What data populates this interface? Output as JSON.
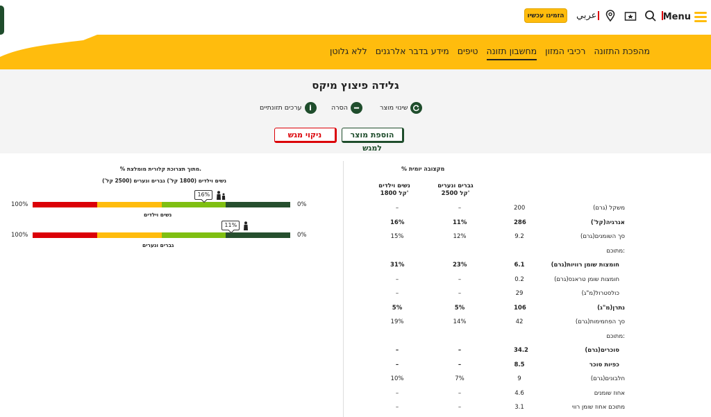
{
  "header": {
    "menu_label": "Menu",
    "order_button": "הזמינו עכשיו",
    "language_link": "عربي"
  },
  "nav": {
    "items": [
      "מהפכת התזונה",
      "רכיבי המזון",
      "מחשבון תזונה",
      "טיפים",
      "מידע בדבר אלרגנים",
      "ללא גלוטן"
    ],
    "active_index": 2
  },
  "product": {
    "title": "גלידה פיצוץ מיקס",
    "legend": {
      "change_product": "שינוי מוצר",
      "remove": "הסרה",
      "nutrition_values": "ערכים תזונתיים"
    },
    "add_to_tray": "הוספת מוצר למגש",
    "clear_tray": "ניקוי מגש"
  },
  "table": {
    "daily_header": "% מקצובה יומית",
    "col_men": [
      "גברים ונערים",
      "2500 קל'"
    ],
    "col_women": [
      "נשים וילדים",
      "1800 קל'"
    ],
    "rows": [
      {
        "label": "משקל (גרם)",
        "value": "200",
        "men": "–",
        "women": "–",
        "bold": false,
        "indent": false
      },
      {
        "label": "אנרגיה(קל')",
        "value": "286",
        "men": "11%",
        "women": "16%",
        "bold": true,
        "indent": false
      },
      {
        "label": "סך השומנים(גרם)",
        "value": "9.2",
        "men": "12%",
        "women": "15%",
        "bold": false,
        "indent": false
      },
      {
        "label": "מתוכם:",
        "value": "",
        "men": "",
        "women": "",
        "bold": false,
        "indent": false
      },
      {
        "label": "חומצות שומן רוויות(גרם)",
        "value": "6.1",
        "men": "23%",
        "women": "31%",
        "bold": true,
        "indent": true
      },
      {
        "label": "חומצות שומן טראנס(גרם)",
        "value": "0.2",
        "men": "–",
        "women": "–",
        "bold": false,
        "indent": true
      },
      {
        "label": "כולסטרול(מ\"ג)",
        "value": "29",
        "men": "–",
        "women": "–",
        "bold": false,
        "indent": true
      },
      {
        "label": "נתרן(מ\"ג)",
        "value": "106",
        "men": "5%",
        "women": "5%",
        "bold": true,
        "indent": false
      },
      {
        "label": "סך הפחמימות(גרם)",
        "value": "42",
        "men": "14%",
        "women": "19%",
        "bold": false,
        "indent": false
      },
      {
        "label": "מתוכם:",
        "value": "",
        "men": "",
        "women": "",
        "bold": false,
        "indent": false
      },
      {
        "label": "סוכרים(גרם)",
        "value": "34.2",
        "men": "–",
        "women": "–",
        "bold": true,
        "indent": true
      },
      {
        "label": "כפיות סוכר",
        "value": "8.5",
        "men": "–",
        "women": "–",
        "bold": true,
        "indent": true
      },
      {
        "label": "חלבונים(גרם)",
        "value": "9",
        "men": "7%",
        "women": "10%",
        "bold": false,
        "indent": false
      },
      {
        "label": "אחוז שומנים",
        "value": "4.6",
        "men": "–",
        "women": "–",
        "bold": false,
        "indent": false
      },
      {
        "label": "מתוכם אחוז שומן רווי",
        "value": "3.1",
        "men": "–",
        "women": "–",
        "bold": false,
        "indent": false
      }
    ]
  },
  "calorie_bars": {
    "heading": "% מתוך תצרוכת קלורית מומלצת.",
    "subheading": "נשים וילדים (1800 קל') גברים ונערים (2500 קל')",
    "left_label": "100%",
    "right_label": "0%",
    "bars": [
      {
        "label": "נשים וילדים",
        "percent_text": "16%",
        "percent": 16
      },
      {
        "label": "גברים ונערים",
        "percent_text": "11%",
        "percent": 11
      }
    ],
    "colors": [
      "#db0007",
      "#ffbc0d",
      "#7fbf12",
      "#264f2e"
    ]
  }
}
